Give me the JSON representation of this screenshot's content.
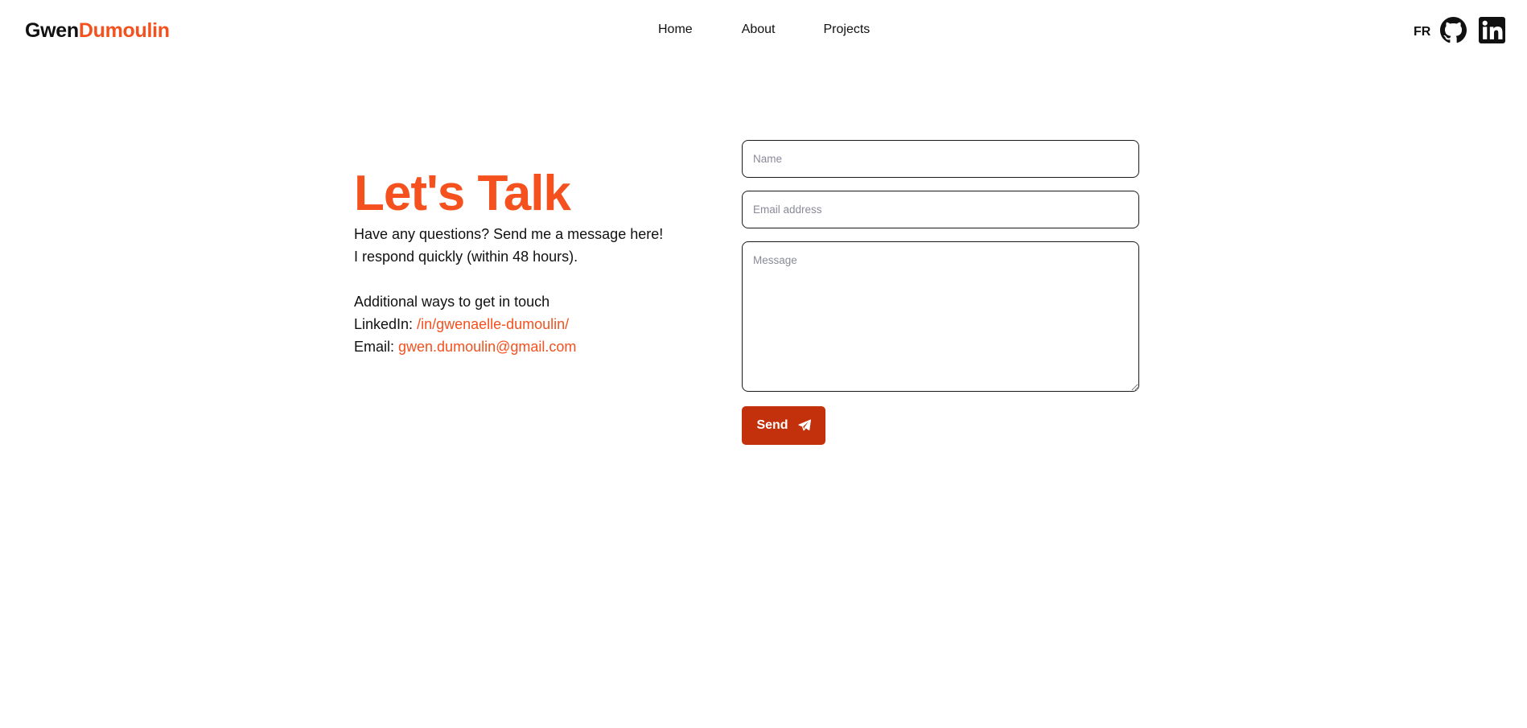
{
  "header": {
    "logo_first": "Gwen",
    "logo_last": "Dumoulin",
    "nav": [
      "Home",
      "About",
      "Projects"
    ],
    "lang": "FR",
    "icons": [
      "github-icon",
      "linkedin-icon"
    ]
  },
  "contact": {
    "title": "Let's Talk",
    "line1": "Have any questions? Send me a message here!",
    "line2": "I respond quickly (within 48 hours).",
    "additional": "Additional ways to get in touch",
    "linkedin_label": "LinkedIn: ",
    "linkedin_link": "/in/gwenaelle-dumoulin/",
    "email_label": "Email: ",
    "email_link": "gwen.dumoulin@gmail.com"
  },
  "form": {
    "name_placeholder": "Name",
    "email_placeholder": "Email address",
    "message_placeholder": "Message",
    "send_label": "Send"
  },
  "colors": {
    "accent": "#f4511e",
    "button": "#c2310b",
    "text": "#111111"
  }
}
